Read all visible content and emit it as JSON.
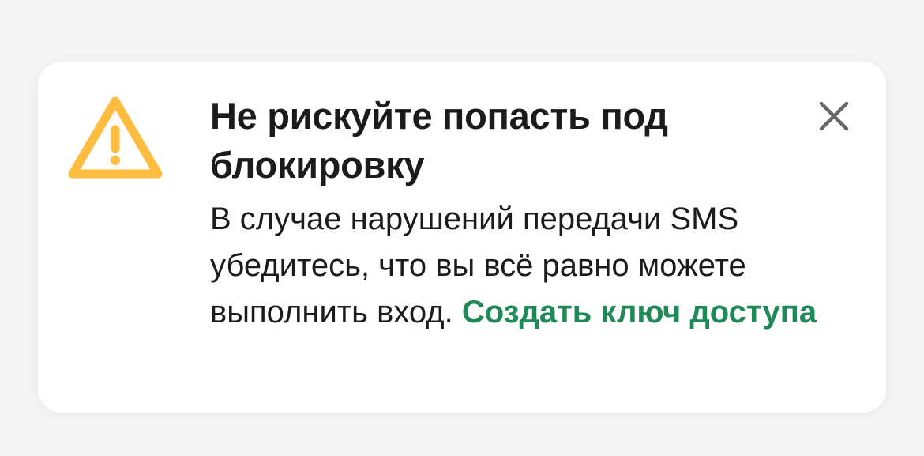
{
  "alert": {
    "icon": "warning-triangle-icon",
    "accent_color": "#FFBC3E",
    "link_color": "#1F8A57",
    "title": "Не рискуйте попасть под блокировку",
    "message": "В случае нарушений передачи SMS убедитесь, что вы всё равно можете выполнить вход.",
    "link_label": "Создать ключ доступа",
    "close_icon": "close-icon"
  }
}
